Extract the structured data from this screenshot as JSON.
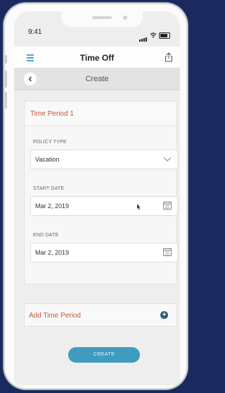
{
  "status_bar": {
    "time": "9:41"
  },
  "header": {
    "title": "Time Off",
    "menu_icon": "hamburger-icon",
    "share_icon": "share-icon"
  },
  "subheader": {
    "title": "Create",
    "back_icon": "chevron-left-icon"
  },
  "period": {
    "title": "Time Period 1",
    "policy_type": {
      "label": "POLICY TYPE",
      "value": "Vacation"
    },
    "start_date": {
      "label": "START DATE",
      "value": "Mar 2, 2019"
    },
    "end_date": {
      "label": "END DATE",
      "value": "Mar 2, 2019"
    }
  },
  "add_period": {
    "label": "Add Time Period",
    "icon": "plus-circle-icon"
  },
  "create_button": {
    "label": "CREATE"
  },
  "colors": {
    "accent": "#3f9bbf",
    "title_red": "#c8543a",
    "plus_blue": "#2a5f7c",
    "background": "#1b2a5e"
  }
}
